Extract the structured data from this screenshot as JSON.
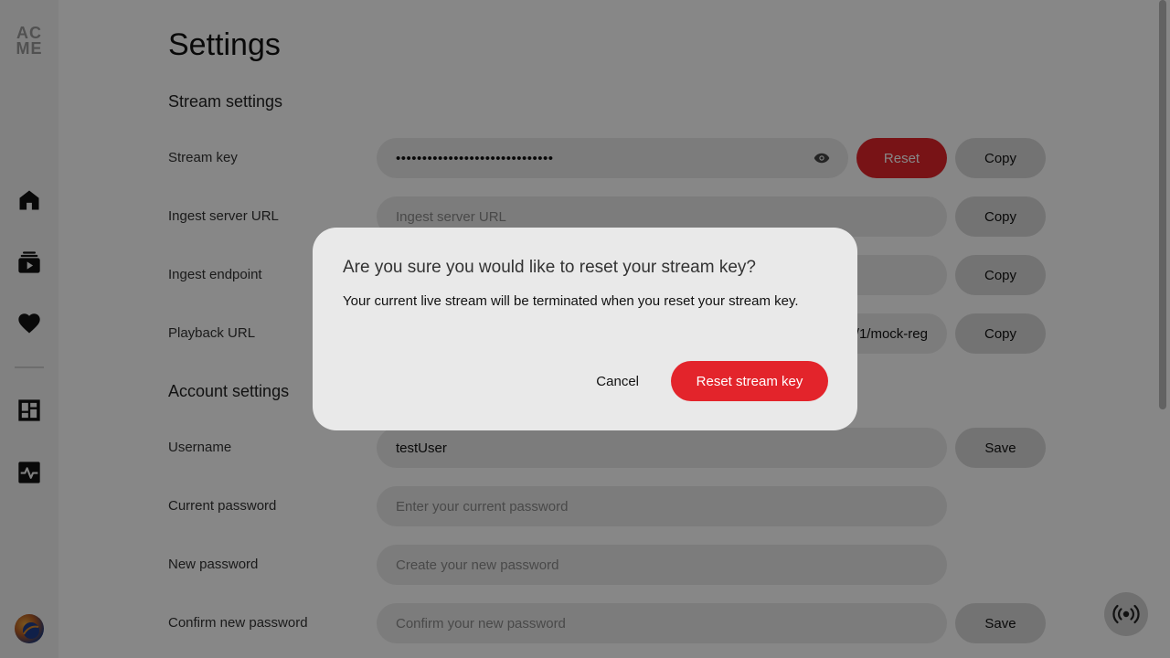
{
  "sidebar": {
    "logo_top": "AC",
    "logo_bottom": "ME",
    "items": [
      {
        "icon": "home-icon"
      },
      {
        "icon": "stream-library-icon"
      },
      {
        "icon": "heart-icon"
      },
      {
        "icon": "dashboard-icon"
      },
      {
        "icon": "activity-icon"
      }
    ]
  },
  "page": {
    "title": "Settings"
  },
  "stream_settings": {
    "heading": "Stream settings",
    "stream_key": {
      "label": "Stream key",
      "value": "••••••••••••••••••••••••••••••",
      "reset_label": "Reset",
      "copy_label": "Copy"
    },
    "ingest_server_url": {
      "label": "Ingest server URL",
      "placeholder": "Ingest server URL",
      "copy_label": "Copy"
    },
    "ingest_endpoint": {
      "label": "Ingest endpoint",
      "copy_label": "Copy"
    },
    "playback_url": {
      "label": "Playback URL",
      "visible_value": "/1/mock-reg",
      "copy_label": "Copy"
    }
  },
  "account_settings": {
    "heading": "Account settings",
    "username": {
      "label": "Username",
      "value": "testUser",
      "save_label": "Save"
    },
    "current_password": {
      "label": "Current password",
      "placeholder": "Enter your current password"
    },
    "new_password": {
      "label": "New password",
      "placeholder": "Create your new password"
    },
    "confirm_password": {
      "label": "Confirm new password",
      "placeholder": "Confirm your new password",
      "save_label": "Save"
    }
  },
  "modal": {
    "title": "Are you sure you would like to reset your stream key?",
    "body": "Your current live stream will be terminated when you reset your stream key.",
    "cancel_label": "Cancel",
    "confirm_label": "Reset stream key"
  },
  "colors": {
    "accent_red": "#e3242b",
    "overlay": "rgba(0,0,0,0.47)",
    "field_bg": "#eaeaea",
    "button_bg": "#d9d9d9"
  }
}
